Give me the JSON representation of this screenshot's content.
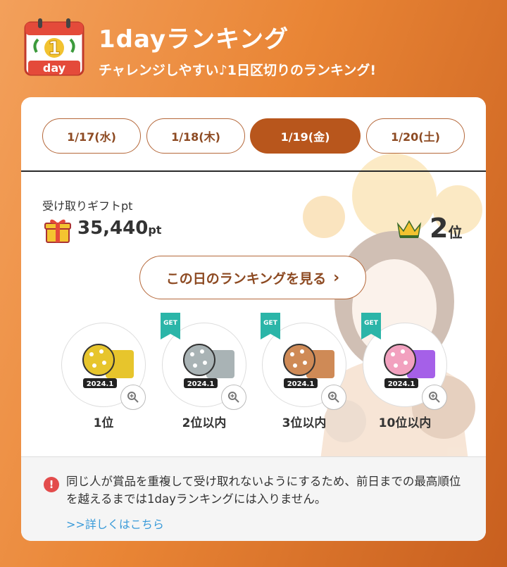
{
  "header": {
    "logo_number": "1",
    "logo_text": "day",
    "title": "1dayランキング",
    "subtitle": "チャレンジしやすい♪1日区切りのランキング!"
  },
  "tabs": [
    {
      "label": "1/17(水)",
      "active": false
    },
    {
      "label": "1/18(木)",
      "active": false
    },
    {
      "label": "1/19(金)",
      "active": true
    },
    {
      "label": "1/20(土)",
      "active": false
    }
  ],
  "gift_points": {
    "label": "受け取りギフトpt",
    "value": "35,440",
    "unit": "pt"
  },
  "rank": {
    "value": "2",
    "unit": "位"
  },
  "view_button": {
    "label": "この日のランキングを見る",
    "chevron": "›"
  },
  "prizes": [
    {
      "label": "1位",
      "get_badge": false,
      "badge_year": "2024.1",
      "color": "#e7c52c"
    },
    {
      "label": "2位以内",
      "get_badge": true,
      "badge_year": "2024.1",
      "color": "#a9b3b5"
    },
    {
      "label": "3位以内",
      "get_badge": true,
      "badge_year": "2024.1",
      "color": "#cf8a56"
    },
    {
      "label": "10位以内",
      "get_badge": true,
      "badge_year": "2024.1",
      "color": "#f2a1bf"
    }
  ],
  "get_text": "GET",
  "notice": {
    "text": "同じ人が賞品を重複して受け取れないようにするため、前日までの最高順位を越えるまでは1dayランキングには入りません。",
    "link": ">>詳しくはこちら"
  },
  "colors": {
    "accent": "#b8561c",
    "brown_text": "#8d4a22",
    "link": "#3a9bd9",
    "warn": "#e34c4c"
  }
}
